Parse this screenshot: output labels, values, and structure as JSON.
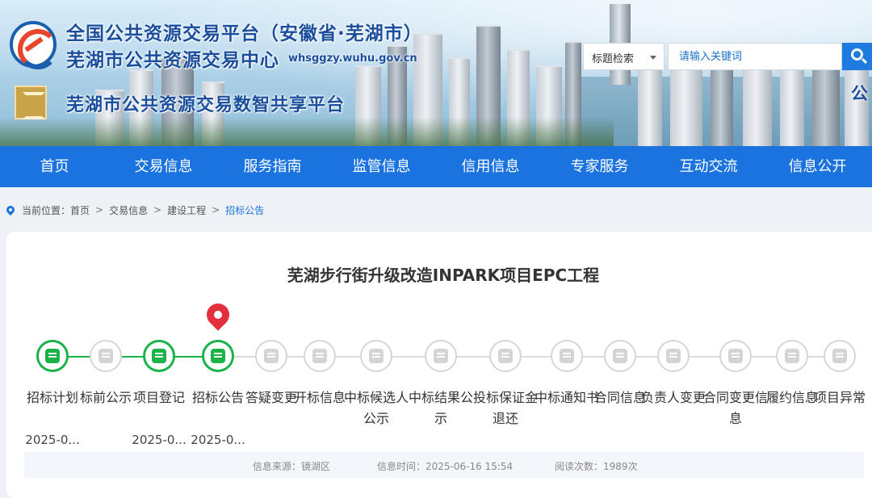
{
  "header": {
    "title_line1": "全国公共资源交易平台（安徽省·芜湖市）",
    "title_line2": "芜湖市公共资源交易中心",
    "domain": "whsggzy.wuhu.gov.cn",
    "title_line3": "芜湖市公共资源交易数智共享平台",
    "edge_char": "公"
  },
  "search": {
    "scope_selected": "标题检索",
    "placeholder": "请输入关键词"
  },
  "nav": {
    "items": [
      "首页",
      "交易信息",
      "服务指南",
      "监管信息",
      "信用信息",
      "专家服务",
      "互动交流",
      "信息公开"
    ]
  },
  "breadcrumb": {
    "prefix": "当前位置：",
    "items": [
      "首页",
      "交易信息",
      "建设工程"
    ],
    "separator": ">",
    "current": "招标公告"
  },
  "project": {
    "title": "芜湖步行街升级改造INPARK项目EPC工程"
  },
  "timeline": {
    "steps": [
      {
        "label": "招标计划",
        "date": "2025-0...",
        "status": "done"
      },
      {
        "label": "标前公示",
        "date": "",
        "status": "pending"
      },
      {
        "label": "项目登记",
        "date": "2025-0...",
        "status": "done"
      },
      {
        "label": "招标公告",
        "date": "2025-0...",
        "status": "current"
      },
      {
        "label": "答疑变更",
        "date": "",
        "status": "pending"
      },
      {
        "label": "开标信息",
        "date": "",
        "status": "pending"
      },
      {
        "label": "中标候选人公示",
        "date": "",
        "status": "pending"
      },
      {
        "label": "中标结果公示",
        "date": "",
        "status": "pending"
      },
      {
        "label": "投标保证金退还",
        "date": "",
        "status": "pending"
      },
      {
        "label": "中标通知书",
        "date": "",
        "status": "pending"
      },
      {
        "label": "合同信息",
        "date": "",
        "status": "pending"
      },
      {
        "label": "负责人变更",
        "date": "",
        "status": "pending"
      },
      {
        "label": "合同变更信息",
        "date": "",
        "status": "pending"
      },
      {
        "label": "履约信息",
        "date": "",
        "status": "pending"
      },
      {
        "label": "项目异常",
        "date": "",
        "status": "pending"
      }
    ]
  },
  "info": {
    "source": "信息来源：镜湖区",
    "time": "信息时间：2025-06-16 15:54",
    "views": "阅读次数：1989次"
  },
  "colors": {
    "nav_bg": "#1a73de",
    "done_green": "#1ab34a",
    "marker_red": "#e4303c",
    "title_blue": "#1b4e9c"
  }
}
